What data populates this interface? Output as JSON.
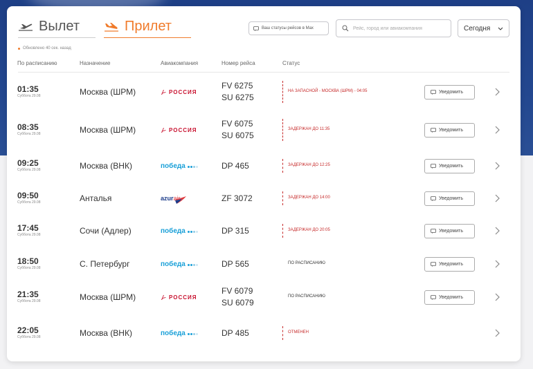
{
  "tabs": {
    "departure": "Вылет",
    "arrival": "Прилет"
  },
  "updated": "Обновлено 40 сек. назад",
  "status_mail": "Ваш статусы рейсов в Max",
  "search": {
    "placeholder": "Рейс, город или авиакомпания"
  },
  "date_select": "Сегодня",
  "columns": {
    "scheduled": "По расписанию",
    "destination": "Назначение",
    "airline": "Авиакомпания",
    "flight": "Номер рейса",
    "status": "Статус"
  },
  "notify_label": "Уведомить",
  "airline_logos": {
    "aeroflot": "РОССИЯ",
    "pobeda": "победа",
    "azur_brand": "azur",
    "azur_air": "air"
  },
  "colors": {
    "accent": "#f07b2b",
    "status_red": "#c62828",
    "header_bg": "#23478f"
  },
  "flights": [
    {
      "time": "01:35",
      "date": "Суббота 29.08",
      "destination": "Москва (ШРМ)",
      "airline": "aeroflot",
      "flights": [
        "FV 6275",
        "SU 6275"
      ],
      "status": "НА ЗАПАСНОЙ - МОСКВА (ШРМ) - 04:05",
      "status_type": "red",
      "notify": true
    },
    {
      "time": "08:35",
      "date": "Суббота 29.08",
      "destination": "Москва (ШРМ)",
      "airline": "aeroflot",
      "flights": [
        "FV 6075",
        "SU 6075"
      ],
      "status": "ЗАДЕРЖАН ДО 11:35",
      "status_type": "red",
      "notify": true
    },
    {
      "time": "09:25",
      "date": "Суббота 29.08",
      "destination": "Москва (ВНК)",
      "airline": "pobeda",
      "flights": [
        "DP 465"
      ],
      "status": "ЗАДЕРЖАН ДО 12:25",
      "status_type": "red",
      "notify": true
    },
    {
      "time": "09:50",
      "date": "Суббота 29.08",
      "destination": "Анталья",
      "airline": "azur",
      "flights": [
        "ZF 3072"
      ],
      "status": "ЗАДЕРЖАН ДО 14:00",
      "status_type": "red",
      "notify": true
    },
    {
      "time": "17:45",
      "date": "Суббота 29.08",
      "destination": "Сочи (Адлер)",
      "airline": "pobeda",
      "flights": [
        "DP 315"
      ],
      "status": "ЗАДЕРЖАН ДО 20:05",
      "status_type": "red",
      "notify": true
    },
    {
      "time": "18:50",
      "date": "Суббота 29.08",
      "destination": "С. Петербург",
      "airline": "pobeda",
      "flights": [
        "DP 565"
      ],
      "status": "ПО РАСПИСАНИЮ",
      "status_type": "dark",
      "notify": true
    },
    {
      "time": "21:35",
      "date": "Суббота 29.08",
      "destination": "Москва (ШРМ)",
      "airline": "aeroflot",
      "flights": [
        "FV 6079",
        "SU 6079"
      ],
      "status": "ПО РАСПИСАНИЮ",
      "status_type": "dark",
      "notify": true
    },
    {
      "time": "22:05",
      "date": "Суббота 29.08",
      "destination": "Москва (ВНК)",
      "airline": "pobeda",
      "flights": [
        "DP 485"
      ],
      "status": "ОТМЕНЕН",
      "status_type": "red",
      "notify": false
    }
  ]
}
